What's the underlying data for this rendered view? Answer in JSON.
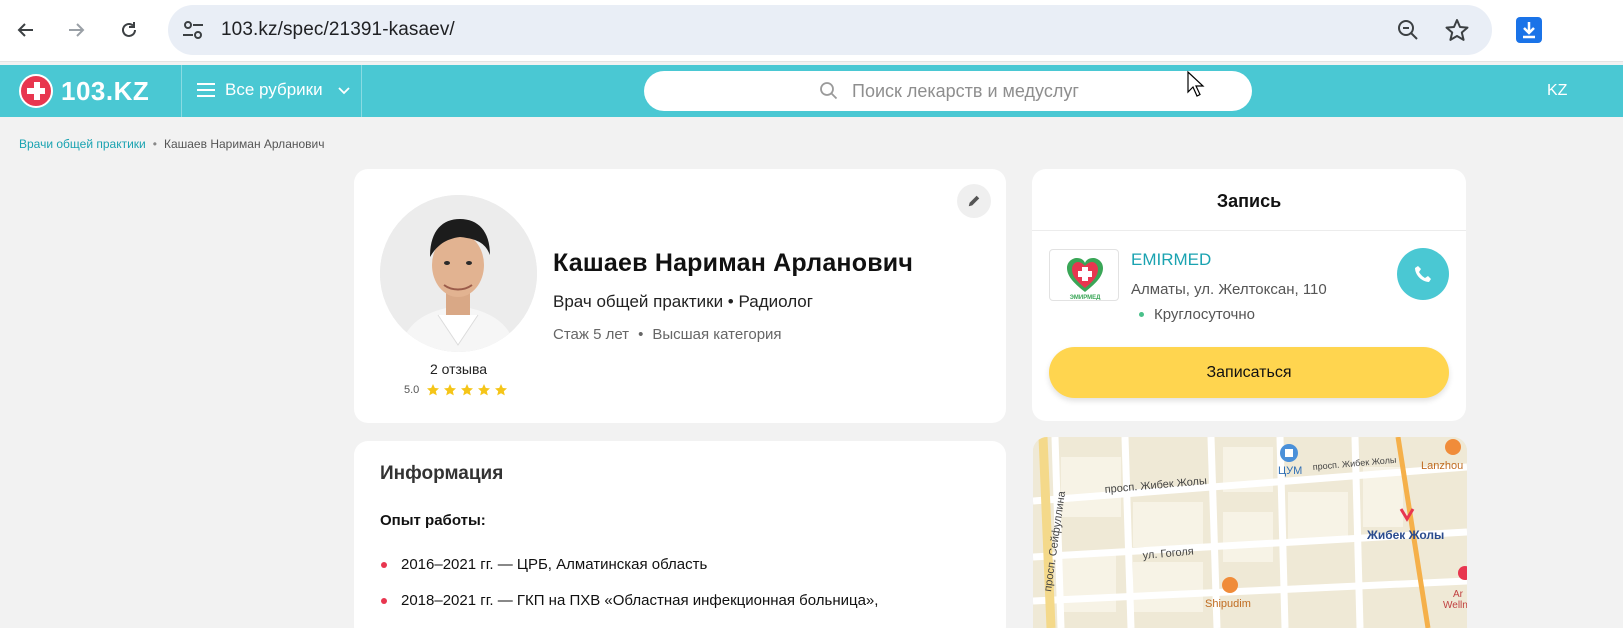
{
  "browser": {
    "url": "103.kz/spec/21391-kasaev/",
    "icons": [
      "back-arrow-icon",
      "forward-arrow-icon",
      "reload-icon",
      "site-settings-icon",
      "zoom-icon",
      "bookmark-star-icon",
      "download-icon"
    ]
  },
  "header": {
    "logo_text": "103.KZ",
    "rubrics_label": "Все рубрики",
    "search_placeholder": "Поиск лекарств и медуслуг",
    "lang": "KZ"
  },
  "breadcrumb": {
    "items": [
      "Врачи общей практики",
      "Кашаев Нариман Арланович"
    ]
  },
  "doctor": {
    "name": "Кашаев Нариман Арланович",
    "specialties": "Врач общей практики • Радиолог",
    "experience": "Стаж 5 лет",
    "meta_sep": "•",
    "category": "Высшая категория",
    "reviews": "2 отзыва",
    "rating": "5.0",
    "stars": 5
  },
  "info": {
    "title": "Информация",
    "experience_title": "Опыт работы:",
    "experience_items": [
      "2016–2021 гг. — ЦРБ, Алматинская область",
      "2018–2021 гг. — ГКП на ПХВ «Областная инфекционная больница»,"
    ]
  },
  "booking": {
    "title": "Запись",
    "clinic_name": "EMIRMED",
    "clinic_logo_text": "ЭМИРМЕД",
    "address": "Алматы, ул. Желтоксан, 110",
    "hours": "Круглосуточно",
    "button_label": "Записаться"
  },
  "map": {
    "labels": {
      "street1": "просп. Жибек Жолы",
      "street2": "просп. Жибек Жолы",
      "street3": "просп. Сейфуллина",
      "street4": "ул. Гоголя",
      "poi1": "ЦУМ",
      "poi2": "Lanzhou",
      "metro": "Жибек Жолы",
      "poi3": "Shipudim",
      "poi4": "Ar",
      "poi5": "Wellne"
    }
  },
  "colors": {
    "brand": "#4ac8d3",
    "accent_red": "#e8364f",
    "button_yellow": "#ffd54f",
    "link": "#1aa3b1",
    "star": "#f5c518"
  }
}
